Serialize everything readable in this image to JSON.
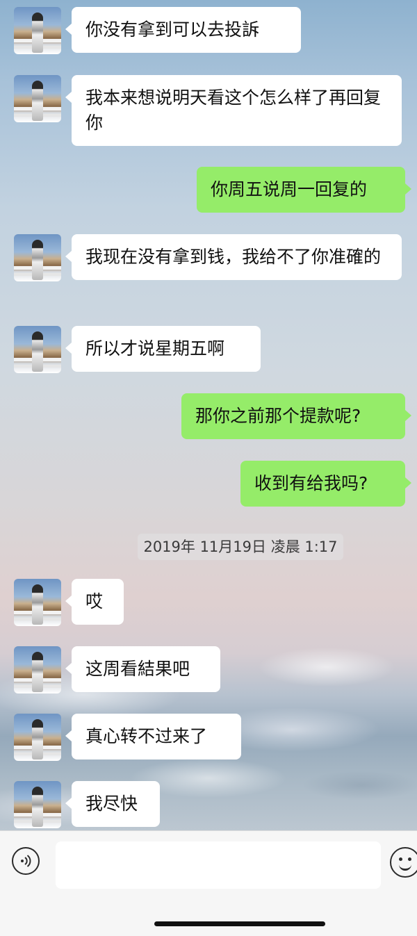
{
  "messages": [
    {
      "side": "left",
      "text": "你没有拿到可以去投訴"
    },
    {
      "side": "left",
      "text": "我本来想说明天看这个怎么样了再回复你"
    },
    {
      "side": "right",
      "text": "你周五说周一回复的"
    },
    {
      "side": "left",
      "text": "我现在没有拿到钱，我给不了你准確的"
    },
    {
      "side": "left",
      "text": "所以才说星期五啊"
    },
    {
      "side": "right",
      "text": "那你之前那个提款呢?"
    },
    {
      "side": "right",
      "text": "收到有给我吗?"
    },
    {
      "side": "left",
      "text": "哎"
    },
    {
      "side": "left",
      "text": "这周看結果吧"
    },
    {
      "side": "left",
      "text": "真心转不过来了"
    },
    {
      "side": "left",
      "text": "我尽快"
    }
  ],
  "timestamp": "2019年 11月19日 凌晨 1:17",
  "input_bar": {
    "voice_icon": "voice-icon",
    "text_value": "",
    "emoji_icon": "emoji-icon"
  },
  "colors": {
    "outgoing_bubble": "#95ec69",
    "incoming_bubble": "#ffffff"
  }
}
